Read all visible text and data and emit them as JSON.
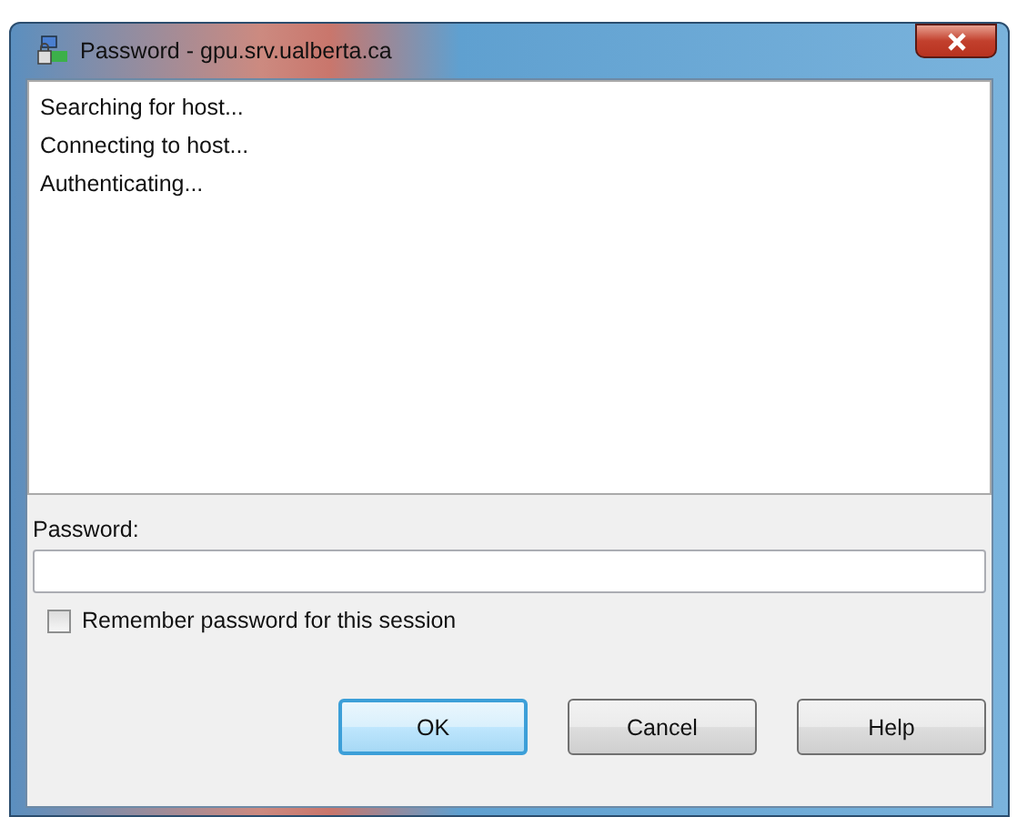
{
  "window": {
    "title": "Password - gpu.srv.ualberta.ca"
  },
  "log": [
    "Searching for host...",
    "Connecting to host...",
    "Authenticating..."
  ],
  "password": {
    "label": "Password:"
  },
  "remember": {
    "label": "Remember password for this session",
    "checked": false
  },
  "buttons": [
    {
      "label": "OK",
      "default": true
    },
    {
      "label": "Cancel",
      "default": false
    },
    {
      "label": "Help",
      "default": false
    }
  ]
}
